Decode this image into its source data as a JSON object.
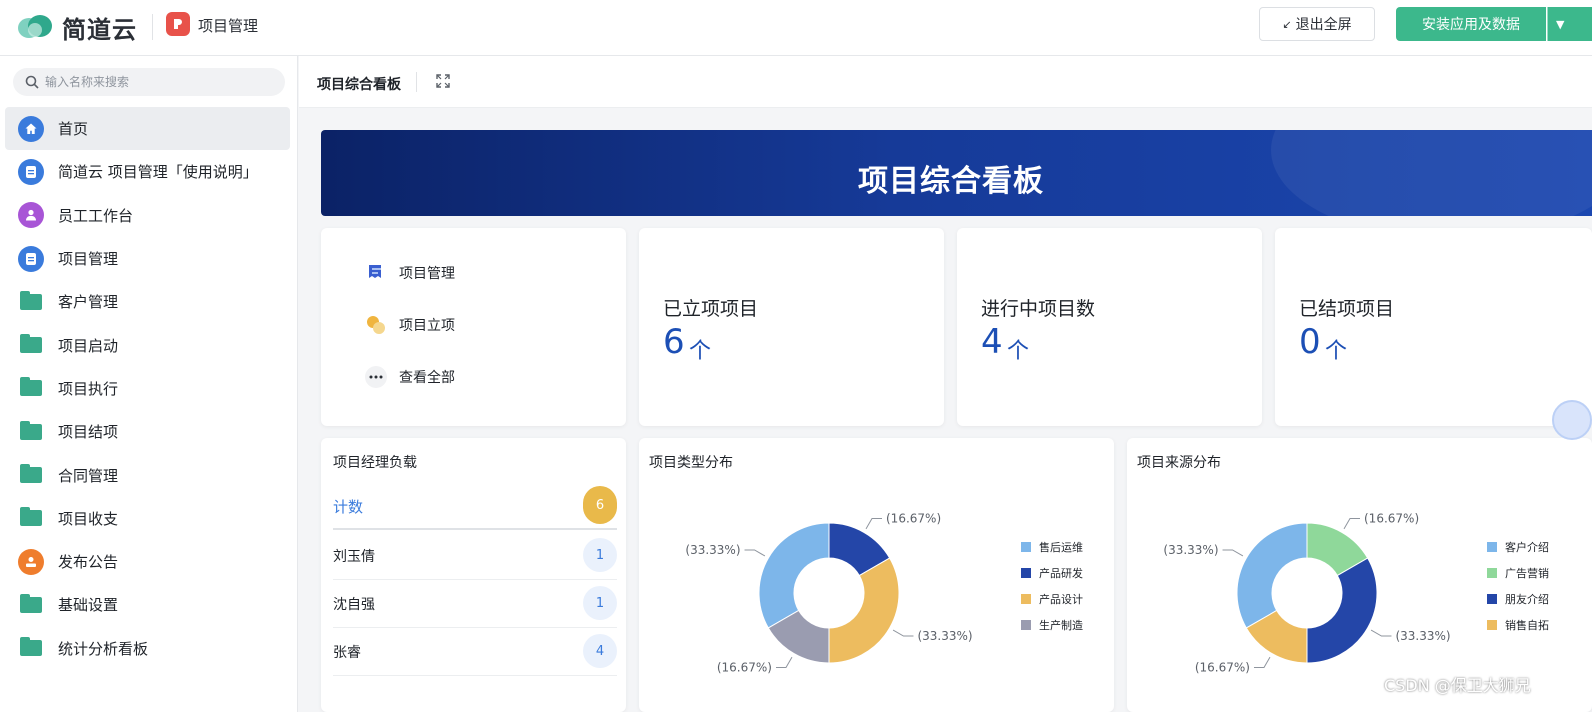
{
  "topbar": {
    "logo_text": "简道云",
    "app_name": "项目管理",
    "exit_fullscreen": "退出全屏",
    "install_button": "安装应用及数据",
    "colors": {
      "primary": "#3cb88c",
      "app_icon": "#e8524a"
    }
  },
  "sidebar": {
    "search_placeholder": "输入名称来搜索",
    "items": [
      {
        "label": "首页",
        "icon": "home-icon",
        "active": true
      },
      {
        "label": "简道云 项目管理「使用说明」",
        "icon": "doc-icon"
      },
      {
        "label": "员工工作台",
        "icon": "user-icon"
      },
      {
        "label": "项目管理",
        "icon": "doc-icon"
      },
      {
        "label": "客户管理",
        "icon": "folder-icon"
      },
      {
        "label": "项目启动",
        "icon": "folder-icon"
      },
      {
        "label": "项目执行",
        "icon": "folder-icon"
      },
      {
        "label": "项目结项",
        "icon": "folder-icon"
      },
      {
        "label": "合同管理",
        "icon": "folder-icon"
      },
      {
        "label": "项目收支",
        "icon": "folder-icon"
      },
      {
        "label": "发布公告",
        "icon": "announce-icon"
      },
      {
        "label": "基础设置",
        "icon": "folder-icon"
      },
      {
        "label": "统计分析看板",
        "icon": "folder-icon"
      }
    ]
  },
  "page": {
    "title": "项目综合看板",
    "banner_title": "项目综合看板"
  },
  "quick_links": [
    {
      "label": "项目管理",
      "icon": "form-icon"
    },
    {
      "label": "项目立项",
      "icon": "approve-icon"
    },
    {
      "label": "查看全部",
      "icon": "more-icon"
    }
  ],
  "stats": [
    {
      "label": "已立项项目",
      "value": "6",
      "unit": "个"
    },
    {
      "label": "进行中项目数",
      "value": "4",
      "unit": "个"
    },
    {
      "label": "已结项项目",
      "value": "0",
      "unit": "个"
    }
  ],
  "pm_load": {
    "title": "项目经理负载",
    "header": {
      "name": "计数",
      "count": "6"
    },
    "rows": [
      {
        "name": "刘玉倩",
        "count": "1"
      },
      {
        "name": "沈自强",
        "count": "1"
      },
      {
        "name": "张睿",
        "count": "4"
      }
    ]
  },
  "chart_data": [
    {
      "type": "pie",
      "title": "项目类型分布",
      "series": [
        {
          "name": "售后运维",
          "value": 33.33,
          "label": "(33.33%)",
          "color": "#7db6ea"
        },
        {
          "name": "产品研发",
          "value": 16.67,
          "label": "(16.67%)",
          "color": "#2446a8"
        },
        {
          "name": "产品设计",
          "value": 33.33,
          "label": "(33.33%)",
          "color": "#edbc5f"
        },
        {
          "name": "生产制造",
          "value": 16.67,
          "label": "(16.67%)",
          "color": "#9a9cb0"
        }
      ]
    },
    {
      "type": "pie",
      "title": "项目来源分布",
      "series": [
        {
          "name": "客户介绍",
          "value": 33.33,
          "label": "(33.33%)",
          "color": "#7db6ea"
        },
        {
          "name": "广告营销",
          "value": 16.67,
          "label": "(16.67%)",
          "color": "#8fd89a"
        },
        {
          "name": "朋友介绍",
          "value": 33.33,
          "label": "(33.33%)",
          "color": "#2446a8"
        },
        {
          "name": "销售自拓",
          "value": 16.67,
          "label": "(16.67%)",
          "color": "#edbc5f"
        }
      ]
    }
  ],
  "watermark": "CSDN @保卫大狮兄"
}
